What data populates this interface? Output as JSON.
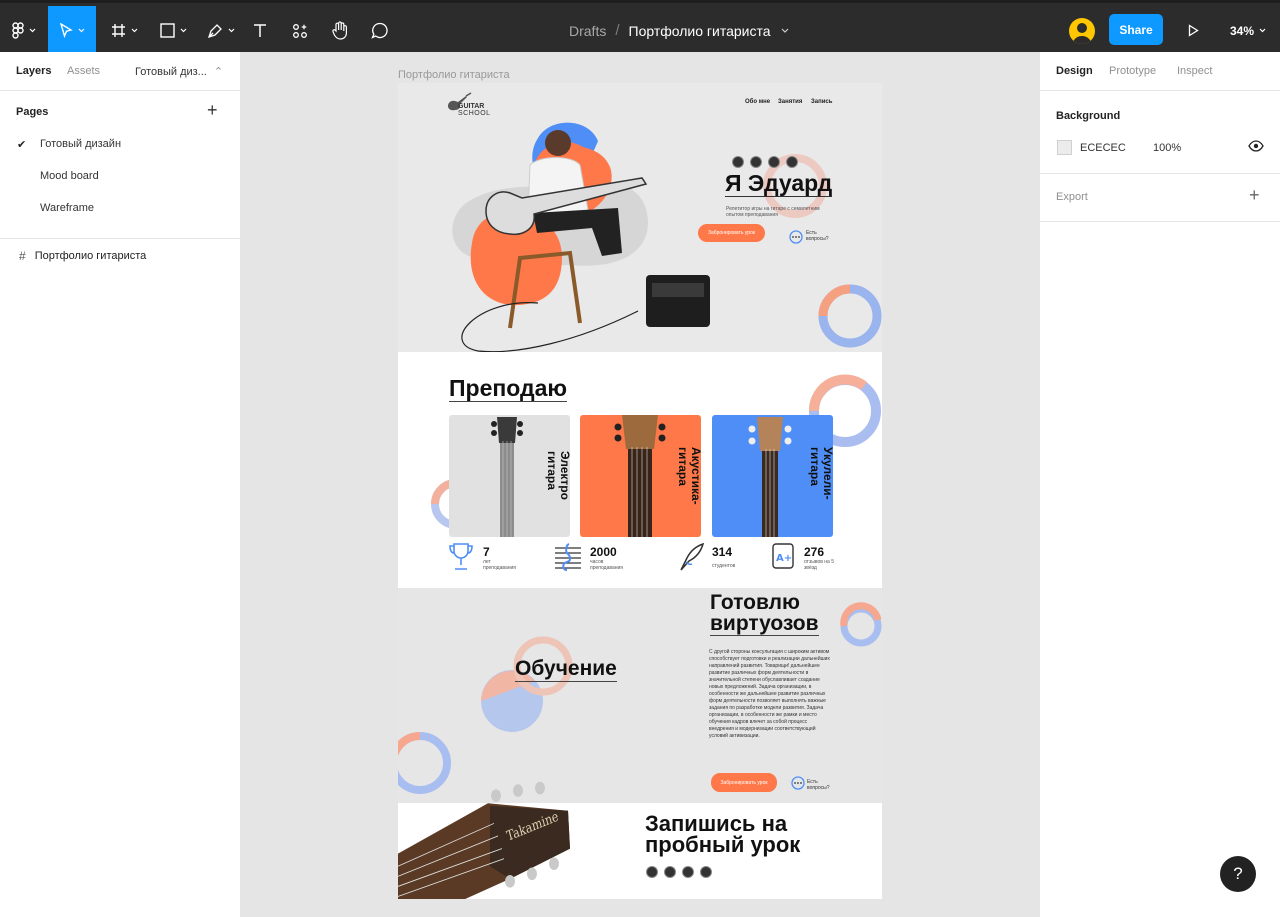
{
  "toolbar": {
    "breadcrumb_project": "Drafts",
    "breadcrumb_separator": "/",
    "file_name": "Портфолио гитариста",
    "share_label": "Share",
    "zoom_label": "34%",
    "accent_color": "#0d99ff"
  },
  "left_panel": {
    "tab_layers": "Layers",
    "tab_assets": "Assets",
    "page_selector": "Готовый диз...",
    "pages_header": "Pages",
    "add_icon": "+",
    "pages": [
      {
        "label": "Готовый дизайн",
        "selected": true
      },
      {
        "label": "Mood board",
        "selected": false
      },
      {
        "label": "Wareframe",
        "selected": false
      }
    ],
    "layers": [
      {
        "label": "Портфолио гитариста",
        "icon": "frame-icon"
      }
    ]
  },
  "right_panel": {
    "tab_design": "Design",
    "tab_prototype": "Prototype",
    "tab_inspect": "Inspect",
    "background_title": "Background",
    "background_hex": "ECECEC",
    "background_opacity": "100%",
    "export_title": "Export",
    "add_icon": "+"
  },
  "canvas": {
    "frame_label": "Портфолио гитариста",
    "design": {
      "logo_line1": "GUITAR",
      "logo_line2": "SCHOOL",
      "nav": [
        "Обо мне",
        "Занятия",
        "Запись"
      ],
      "hero_name": "Я Эдуард",
      "hero_subtitle": "Репетитор игры на гитаре с семилетним опытом преподавания",
      "book_button": "Забронировать урок",
      "questions": "Есть вопросы?",
      "teach_title": "Преподаю",
      "cards": [
        {
          "label": "Электро гитара",
          "color": "#e1e1e1"
        },
        {
          "label": "Акустика- гитара",
          "color": "#ff7849"
        },
        {
          "label": "Укулели- гитара",
          "color": "#4f8ef7"
        }
      ],
      "stats": [
        {
          "value": "7",
          "caption": "лет преподавания"
        },
        {
          "value": "2000",
          "caption": "часов преподавания"
        },
        {
          "value": "314",
          "caption": "студентов"
        },
        {
          "value": "276",
          "caption": "отзывов на 5 звёзд"
        }
      ],
      "virtuoso_title_1": "Готовлю",
      "virtuoso_title_2": "виртуозов",
      "training_title": "Обучение",
      "training_text": "С другой стороны консультация с широким активом способствует подготовки и реализации дальнейших направлений развития. Товарищи! дальнейшее развитие различных форм деятельности в значительной степени обуславливает создание новых предложений. Задача организации, в особенности же дальнейшее развитие различных форм деятельности позволяет выполнять важные задания по разработке модели развития. Задача организации, в особенности же рамки и место обучения кадров влечет за собой процесс внедрения и модернизации соответствующий условий активизации.",
      "book_button_2": "Забронировать урок",
      "questions_2": "Есть вопросы?",
      "cta_line1": "Запишись на",
      "cta_line2": "пробный урок",
      "headstock_brand": "Takamine",
      "orange": "#ff7849",
      "blue": "#4f8ef7"
    }
  },
  "help_label": "?"
}
